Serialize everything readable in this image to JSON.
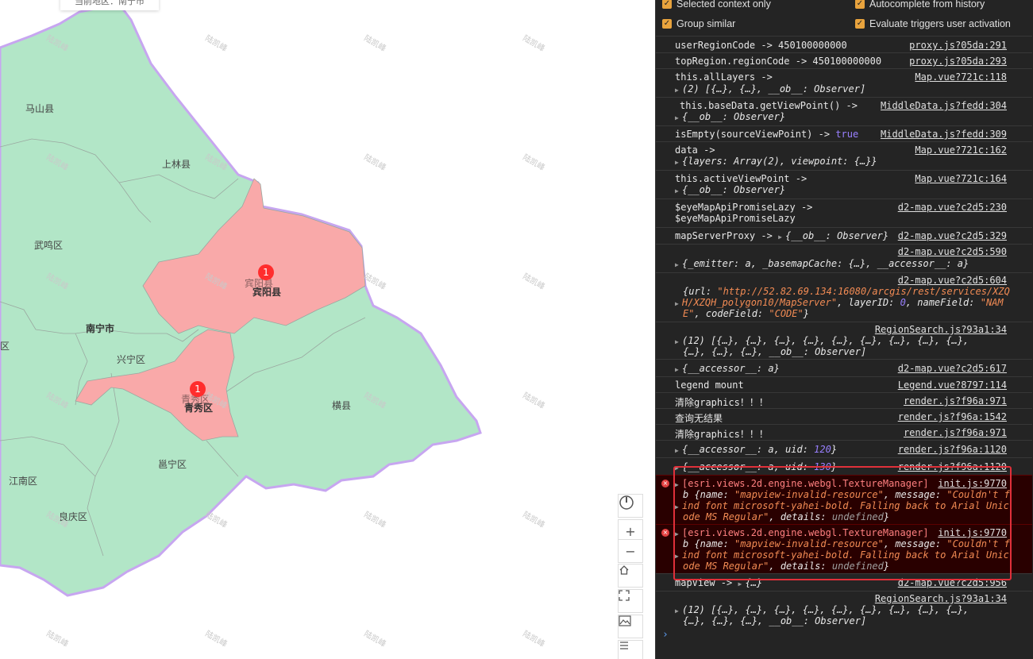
{
  "map": {
    "region_box": "当前地区：南宁市",
    "labels": {
      "mashan": "马山县",
      "shanglin": "上林县",
      "wuming": "武鸣区",
      "binyang_faded": "宾阳县",
      "binyang": "宾阳县",
      "nanning": "南宁市",
      "xingning": "兴宁区",
      "qu_edge": "区",
      "qingxiu_faded": "青秀区",
      "qingxiu": "青秀区",
      "hengxian": "横县",
      "yongning": "邕宁区",
      "jiangnan": "江南区",
      "liangqing": "良庆区"
    },
    "badges": {
      "binyang": "1",
      "qingxiu": "1"
    },
    "watermark": "陆凯峰",
    "controls": {
      "compass": "compass-icon",
      "zoom_in": "+",
      "zoom_out": "−",
      "home": "home-icon",
      "fullscreen": "fullscreen-icon",
      "basemap": "basemap-icon",
      "layers": "layers-icon"
    },
    "colors": {
      "green": "#b2e6c7",
      "red": "#f9a9a9",
      "border": "#c7a6f0"
    }
  },
  "devtools": {
    "options": {
      "selected_context": "Selected context only",
      "autocomplete": "Autocomplete from history",
      "group_similar": "Group similar",
      "evaluate_triggers": "Evaluate triggers user activation"
    },
    "logs": {
      "l1": {
        "text": "userRegionCode -> 450100000000",
        "src": "proxy.js?05da:291"
      },
      "l2": {
        "text": "topRegion.regionCode -> 450100000000",
        "src": "proxy.js?05da:293"
      },
      "l3": {
        "text": "this.allLayers ->",
        "detail": "(2) [{…}, {…}, __ob__: Observer]",
        "src": "Map.vue?721c:118"
      },
      "l4": {
        "text": "this.baseData.getViewPoint() ->",
        "detail": "{__ob__: Observer}",
        "src": "MiddleData.js?fedd:304"
      },
      "l5": {
        "text": "isEmpty(sourceViewPoint) ->",
        "value": "true",
        "src": "MiddleData.js?fedd:309"
      },
      "l6": {
        "text": "data ->",
        "detail": "{layers: Array(2), viewpoint: {…}}",
        "src": "Map.vue?721c:162"
      },
      "l7": {
        "text": "this.activeViewPoint ->",
        "detail": "{__ob__: Observer}",
        "src": "Map.vue?721c:164"
      },
      "l8": {
        "text": "$eyeMapApiPromiseLazy ->",
        "text2": "$eyeMapApiPromiseLazy",
        "src": "d2-map.vue?c2d5:230"
      },
      "l9": {
        "text": "mapServerProxy ->",
        "detail": "{__ob__: Observer}",
        "src": "d2-map.vue?c2d5:329"
      },
      "l10": {
        "detail": "{_emitter: a, _basemapCache: {…}, __accessor__: a}",
        "src": "d2-map.vue?c2d5:590"
      },
      "l11": {
        "src": "d2-map.vue?c2d5:604",
        "line1_pre": "{url: ",
        "line1_str": "\"http://52.82.69.134:16080/arcgis/rest/services/XZQ",
        "line2_str": "H/XZQH_polygon10/MapServer\"",
        "line2_mid": ", layerID: ",
        "line2_num": "0",
        "line2_mid2": ", nameField: ",
        "line2_str2": "\"NAM",
        "line3_str": "E\"",
        "line3_mid": ", codeField: ",
        "line3_str2": "\"CODE\"",
        "line3_end": "}"
      },
      "l12": {
        "src": "RegionSearch.js?93a1:34",
        "line1": "(12) [{…}, {…}, {…}, {…}, {…}, {…}, {…}, {…}, {…},",
        "line2": "{…}, {…}, {…}, __ob__: Observer]"
      },
      "l13": {
        "detail": "{__accessor__: a}",
        "src": "d2-map.vue?c2d5:617"
      },
      "l14": {
        "text": "legend mount",
        "src": "Legend.vue?8797:114"
      },
      "l15": {
        "text": "清除graphics！！！",
        "src": "render.js?f96a:971"
      },
      "l16": {
        "text": "查询无结果",
        "src": "render.js?f96a:1542"
      },
      "l17": {
        "text": "清除graphics！！！",
        "src": "render.js?f96a:971"
      },
      "l18": {
        "pre": "{__accessor__: a, uid: ",
        "num": "120",
        "post": "}",
        "src": "render.js?f96a:1120"
      },
      "l19": {
        "pre": "{__accessor__: a, uid: ",
        "num": "130",
        "post": "}",
        "src": "render.js?f96a:1120"
      },
      "e1": {
        "src": "init.js:9770",
        "head": "[esri.views.2d.engine.webgl.TextureManager]",
        "b_pre": "b {name: ",
        "b_name": "\"mapview-invalid-resource\"",
        "b_mid": ", message: ",
        "b_msg1": "\"Couldn't f",
        "b_msg2": "ind font microsoft-yahei-bold. Falling back to Arial Unic",
        "b_msg3": "ode MS Regular\"",
        "b_det": ", details: ",
        "b_undef": "undefined",
        "b_end": "}"
      },
      "e2": {
        "src": "init.js:9770",
        "head": "[esri.views.2d.engine.webgl.TextureManager]",
        "b_pre": "b {name: ",
        "b_name": "\"mapview-invalid-resource\"",
        "b_mid": ", message: ",
        "b_msg1": "\"Couldn't f",
        "b_msg2": "ind font microsoft-yahei-bold. Falling back to Arial Unic",
        "b_msg3": "ode MS Regular\"",
        "b_det": ", details: ",
        "b_undef": "undefined",
        "b_end": "}"
      },
      "l20": {
        "text": "mapView ->",
        "detail": "{…}",
        "src": "d2-map.vue?c2d5:956"
      },
      "l21": {
        "src": "RegionSearch.js?93a1:34",
        "line1": "(12) [{…}, {…}, {…}, {…}, {…}, {…}, {…}, {…}, {…},",
        "line2": "{…}, {…}, {…}, __ob__: Observer]"
      }
    },
    "prompt": "›"
  }
}
